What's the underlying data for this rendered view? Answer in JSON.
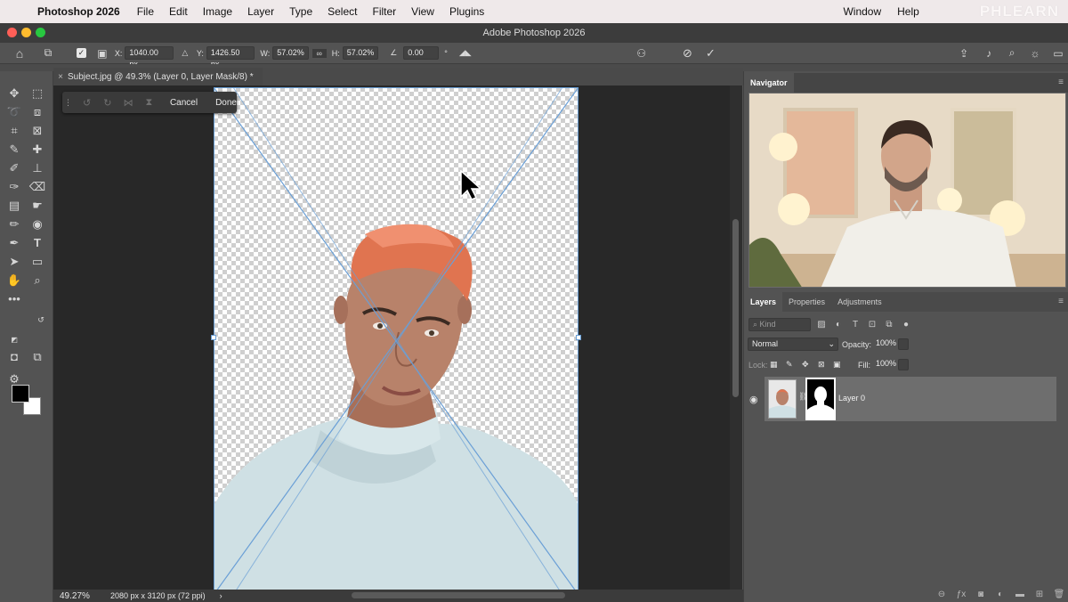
{
  "menubar": {
    "app_name": "Photoshop 2026",
    "items": [
      "File",
      "Edit",
      "Image",
      "Layer",
      "Type",
      "Select",
      "Filter",
      "View",
      "Plugins"
    ],
    "right_items": [
      "Window",
      "Help"
    ],
    "watermark": "PHLEARN"
  },
  "window": {
    "title": "Adobe Photoshop 2026"
  },
  "options": {
    "x_label": "X:",
    "x_value": "1040.00 px",
    "y_label": "Y:",
    "y_value": "1426.50 px",
    "w_label": "W:",
    "w_value": "57.02%",
    "h_label": "H:",
    "h_value": "57.02%",
    "angle_value": "0.00",
    "degree_symbol": "°"
  },
  "document": {
    "tab_title": "Subject.jpg @ 49.3% (Layer 0, Layer Mask/8) *"
  },
  "mask_toolbar": {
    "cancel_label": "Cancel",
    "done_label": "Done"
  },
  "status": {
    "zoom": "49.27%",
    "doc_info": "2080 px x 3120 px (72 ppi)",
    "arrow": "›"
  },
  "navigator": {
    "tab_label": "Navigator"
  },
  "layers_panel": {
    "tabs": [
      "Layers",
      "Properties",
      "Adjustments"
    ],
    "filter_placeholder": "Kind",
    "blend_mode": "Normal",
    "opacity_label": "Opacity:",
    "opacity_value": "100%",
    "lock_label": "Lock:",
    "fill_label": "Fill:",
    "fill_value": "100%",
    "layers": [
      {
        "name": "Layer 0",
        "visible": true
      }
    ]
  },
  "colors": {
    "accent_guide": "#6a9fd6",
    "hair": "#e07450",
    "hoodie": "#cfe0e4",
    "skin": "#b8826a"
  }
}
